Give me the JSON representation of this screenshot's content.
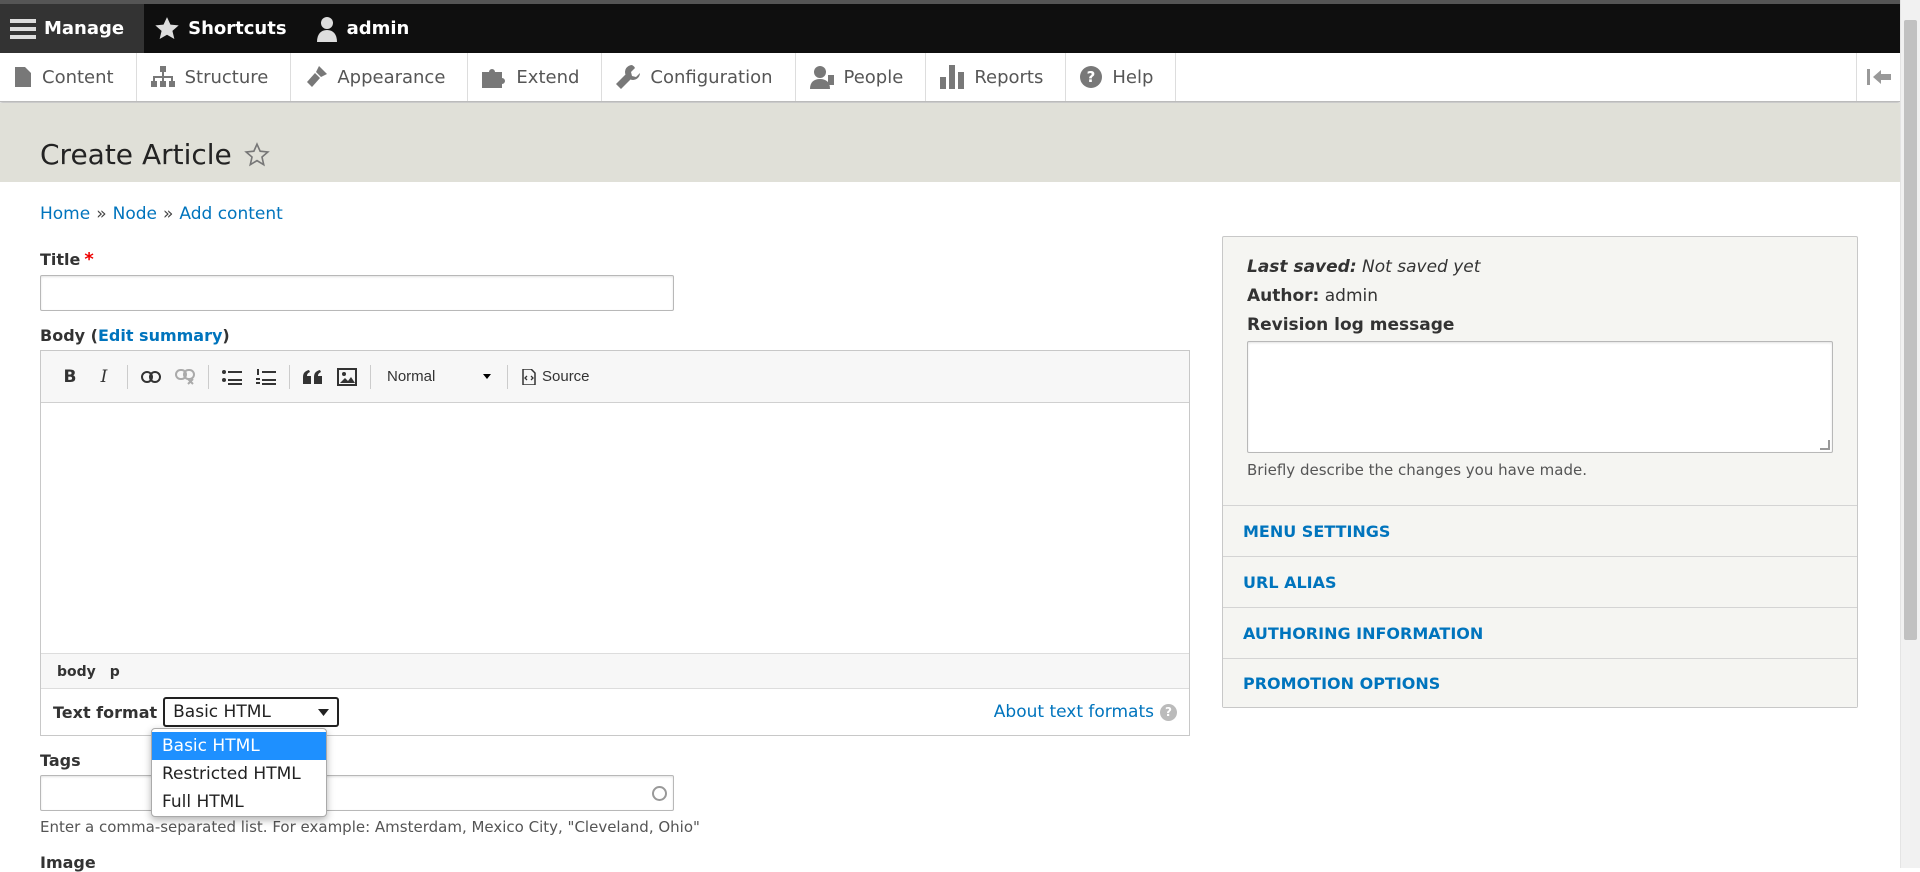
{
  "toolbar": {
    "manage": "Manage",
    "shortcuts": "Shortcuts",
    "user": "admin"
  },
  "tray": {
    "items": [
      {
        "label": "Content",
        "icon": "file-icon"
      },
      {
        "label": "Structure",
        "icon": "sitemap-icon"
      },
      {
        "label": "Appearance",
        "icon": "paintbrush-icon"
      },
      {
        "label": "Extend",
        "icon": "puzzle-icon"
      },
      {
        "label": "Configuration",
        "icon": "wrench-icon"
      },
      {
        "label": "People",
        "icon": "person-icon"
      },
      {
        "label": "Reports",
        "icon": "bar-chart-icon"
      },
      {
        "label": "Help",
        "icon": "question-icon"
      }
    ]
  },
  "page": {
    "title": "Create Article"
  },
  "breadcrumb": {
    "items": [
      "Home",
      "Node",
      "Add content"
    ],
    "separator": "»"
  },
  "form": {
    "title_label": "Title",
    "title_required_mark": "*",
    "title_value": "",
    "body_label": "Body (",
    "edit_summary": "Edit summary",
    "body_label_close": ")",
    "editor": {
      "paragraph_format": "Normal",
      "source_label": "Source",
      "path": [
        "body",
        "p"
      ]
    },
    "text_format_label": "Text format",
    "text_format_selected": "Basic HTML",
    "text_format_options": [
      "Basic HTML",
      "Restricted HTML",
      "Full HTML"
    ],
    "about_text_formats": "About text formats",
    "help_mark": "?",
    "tags_label": "Tags",
    "tags_value": "",
    "tags_description": "Enter a comma-separated list. For example: Amsterdam, Mexico City, \"Cleveland, Ohio\"",
    "image_label": "Image"
  },
  "sidebar": {
    "last_saved_label": "Last saved:",
    "last_saved_value": "Not saved yet",
    "author_label": "Author:",
    "author_value": "admin",
    "revision_label": "Revision log message",
    "revision_value": "",
    "revision_description": "Briefly describe the changes you have made.",
    "sections": [
      "MENU SETTINGS",
      "URL ALIAS",
      "AUTHORING INFORMATION",
      "PROMOTION OPTIONS"
    ]
  },
  "colors": {
    "link": "#0074bd",
    "toolbar_bg": "#0f0f0f",
    "header_bg": "#e0e0d8",
    "dropdown_selected": "#1e90ff"
  }
}
